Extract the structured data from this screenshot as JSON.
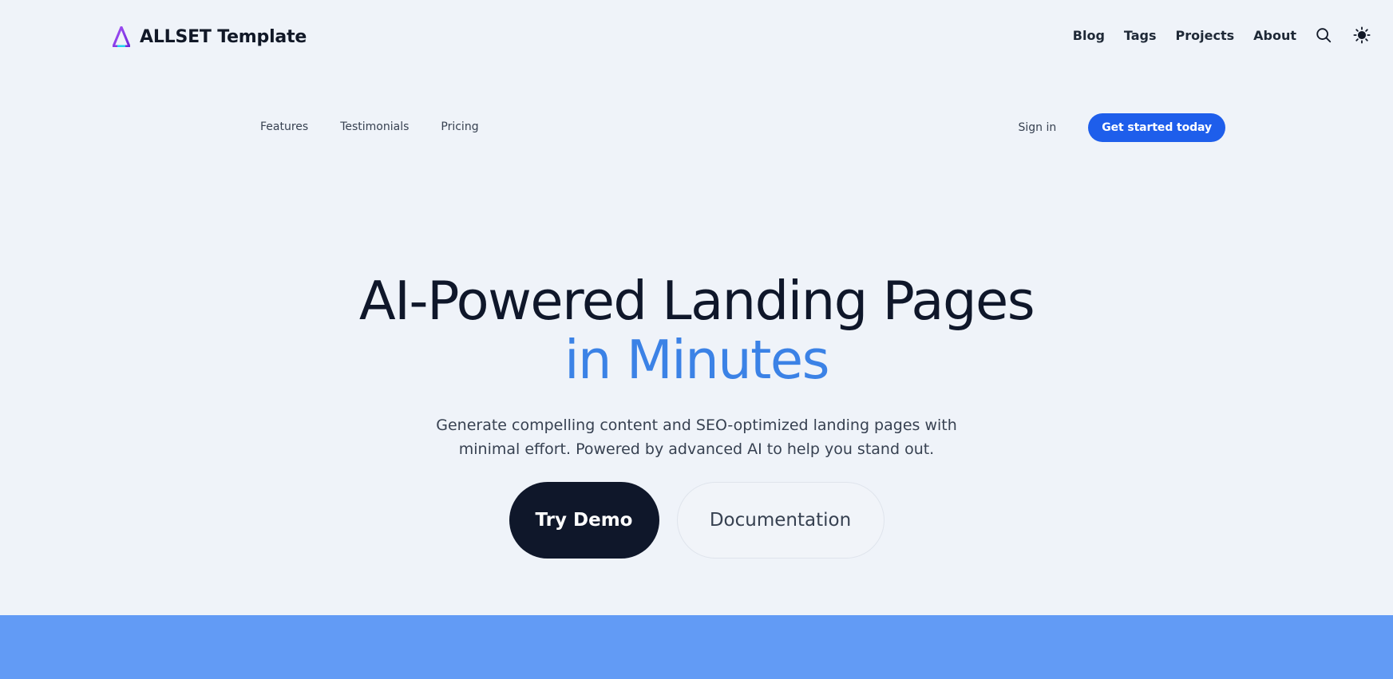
{
  "brand": {
    "name": "ALLSET Template",
    "logo_icon": "triangle-logo-icon"
  },
  "top_nav": {
    "items": [
      "Blog",
      "Tags",
      "Projects",
      "About"
    ],
    "search_icon": "search-icon",
    "theme_icon": "sun-icon"
  },
  "sub_nav": {
    "links": [
      "Features",
      "Testimonials",
      "Pricing"
    ],
    "sign_in": "Sign in",
    "cta": "Get started today"
  },
  "hero": {
    "title_line1": "AI-Powered Landing Pages",
    "title_line2": "in Minutes",
    "subtitle": "Generate compelling content and SEO-optimized landing pages with minimal effort. Powered by advanced AI to help you stand out.",
    "primary_button": "Try Demo",
    "secondary_button": "Documentation"
  },
  "colors": {
    "background": "#eff3f9",
    "accent": "#3b82e6",
    "cta": "#1e5eeb",
    "dark": "#0f172a",
    "band": "#629bf5"
  }
}
